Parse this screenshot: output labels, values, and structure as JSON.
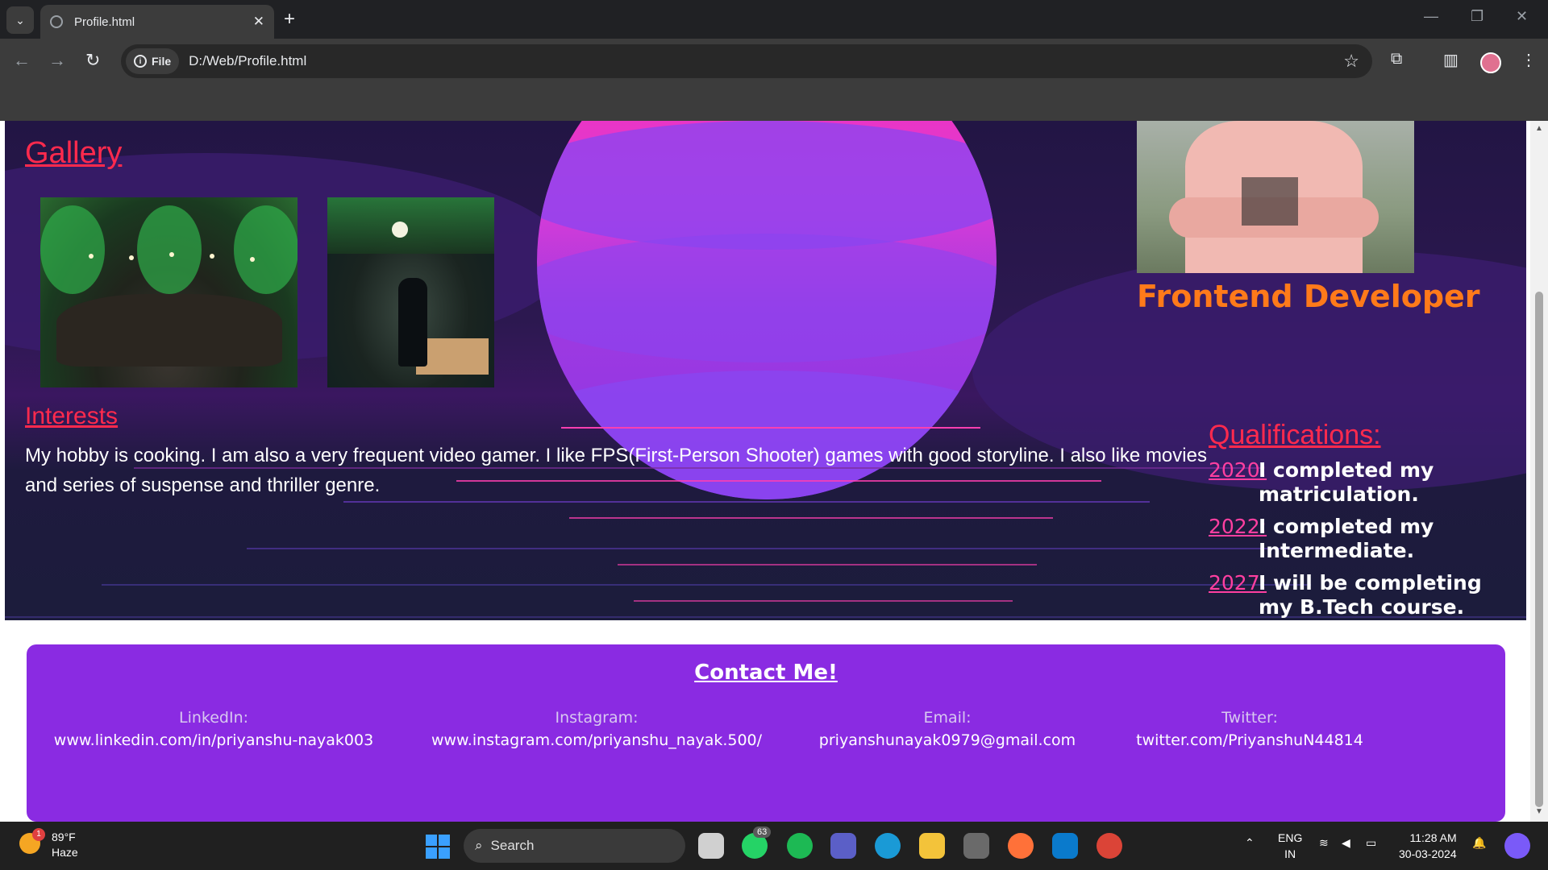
{
  "browser": {
    "tab_title": "Profile.html",
    "chip_label": "File",
    "url": "D:/Web/Profile.html"
  },
  "page": {
    "gallery_title": "Gallery",
    "role": "Frontend Developer",
    "interests_title": "Interests",
    "interests_text": "My hobby is cooking. I am also a very frequent video gamer. I like FPS(First-Person Shooter) games with good storyline. I also like movies and series of suspense and thriller genre.",
    "qualifications_title": "Qualifications:",
    "qualifications": [
      {
        "year": "2020:",
        "text": "I completed my matriculation."
      },
      {
        "year": "2022:",
        "text": "I completed my Intermediate."
      },
      {
        "year": "2027:",
        "text": "I will be completing my B.Tech course."
      }
    ],
    "contact": {
      "title": "Contact Me!",
      "items": [
        {
          "label": "LinkedIn:",
          "value": "www.linkedin.com/in/priyanshu-nayak003"
        },
        {
          "label": "Instagram:",
          "value": "www.instagram.com/priyanshu_nayak.500/"
        },
        {
          "label": "Email:",
          "value": "priyanshunayak0979@gmail.com"
        },
        {
          "label": "Twitter:",
          "value": "twitter.com/PriyanshuN44814"
        }
      ]
    }
  },
  "taskbar": {
    "weather_temp": "89°F",
    "weather_desc": "Haze",
    "weather_badge": "1",
    "search_placeholder": "Search",
    "whatsapp_badge": "63",
    "lang_line1": "ENG",
    "lang_line2": "IN",
    "time": "11:28 AM",
    "date": "30-03-2024"
  },
  "colors": {
    "accent_red": "#ff2a4d",
    "role_orange": "#ff7a1a",
    "contact_purple": "#8a2be2"
  }
}
